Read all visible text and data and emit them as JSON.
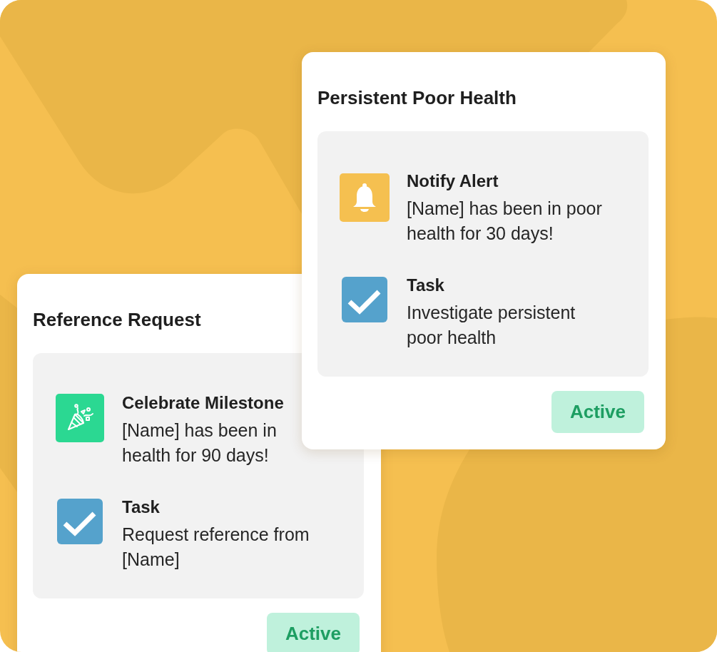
{
  "cards": [
    {
      "title": "Reference Request",
      "actions": [
        {
          "kind": "celebrate",
          "title": "Celebrate Milestone",
          "body": "[Name] has been in health for 90 days!"
        },
        {
          "kind": "task",
          "title": "Task",
          "body": "Request reference from [Name]"
        }
      ],
      "status": "Active"
    },
    {
      "title": "Persistent Poor Health",
      "actions": [
        {
          "kind": "alert",
          "title": "Notify Alert",
          "body": "[Name] has been in poor health for 30 days!"
        },
        {
          "kind": "task",
          "title": "Task",
          "body": "Investigate persistent poor health"
        }
      ],
      "status": "Active"
    }
  ]
}
